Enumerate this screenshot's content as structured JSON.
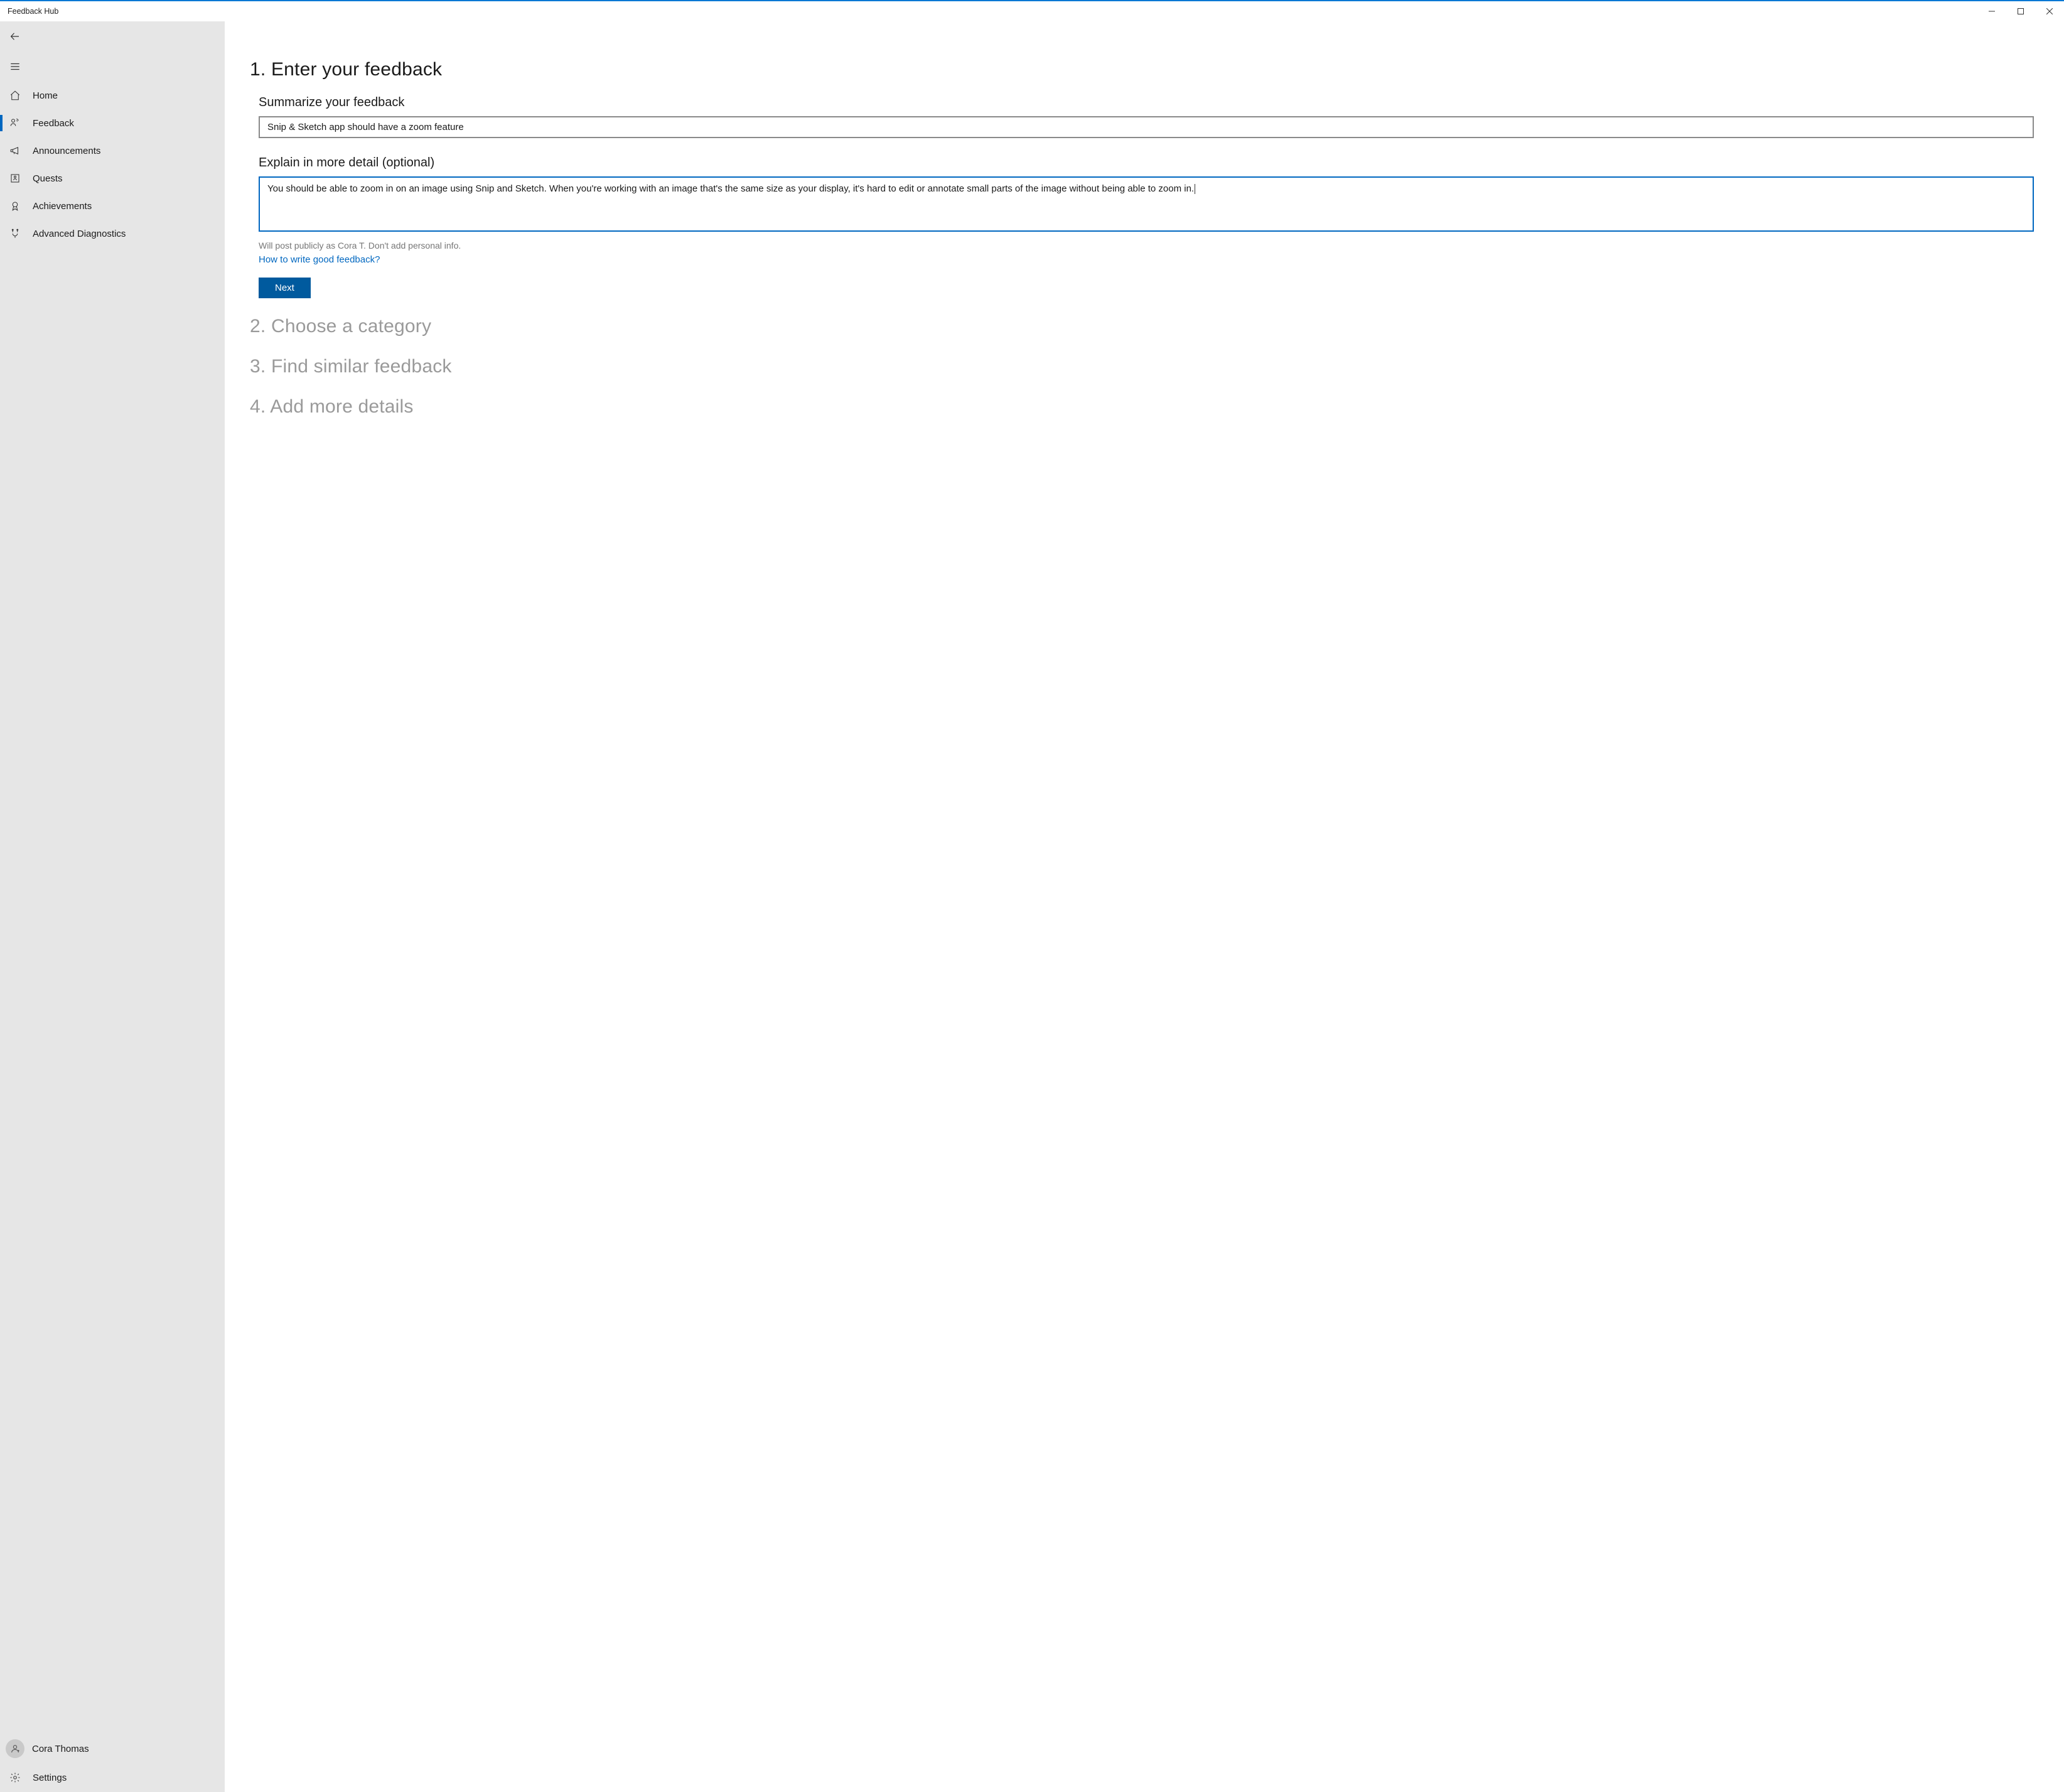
{
  "window": {
    "title": "Feedback Hub"
  },
  "sidebar": {
    "items": [
      {
        "id": "home",
        "label": "Home"
      },
      {
        "id": "feedback",
        "label": "Feedback"
      },
      {
        "id": "announcements",
        "label": "Announcements"
      },
      {
        "id": "quests",
        "label": "Quests"
      },
      {
        "id": "achievements",
        "label": "Achievements"
      },
      {
        "id": "advanced-diagnostics",
        "label": "Advanced Diagnostics"
      }
    ],
    "user": {
      "name": "Cora Thomas"
    },
    "settings_label": "Settings"
  },
  "main": {
    "step1_title": "1. Enter your feedback",
    "summary_label": "Summarize your feedback",
    "summary_value": "Snip & Sketch app should have a zoom feature",
    "detail_label": "Explain in more detail (optional)",
    "detail_value": "You should be able to zoom in on an image using Snip and Sketch. When you're working with an image that's the same size as your display, it's hard to edit or annotate small parts of the image without being able to zoom in.",
    "public_note": "Will post publicly as Cora T. Don't add personal info.",
    "help_link": "How to write good feedback?",
    "next_label": "Next",
    "step2_title": "2. Choose a category",
    "step3_title": "3. Find similar feedback",
    "step4_title": "4. Add more details"
  }
}
